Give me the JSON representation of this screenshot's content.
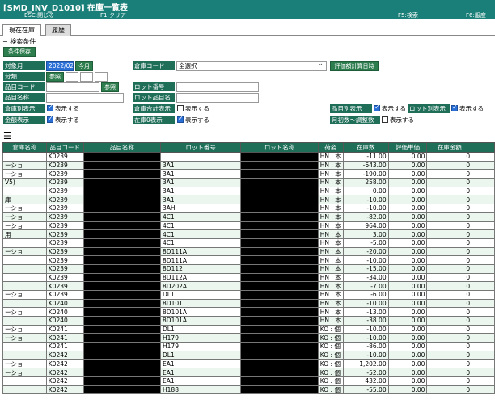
{
  "window": {
    "title": "[SMD_INV_D1010] 在庫一覧表",
    "fkeys": [
      {
        "key": "esc",
        "label": "ESC:閉じる"
      },
      {
        "key": "f1",
        "label": "F1:クリア"
      },
      {
        "key": "f5",
        "label": "F5:検索"
      },
      {
        "key": "f6",
        "label": "F6:服度"
      }
    ]
  },
  "tabs": [
    {
      "label": "現在在庫",
      "active": true
    },
    {
      "label": "履歴",
      "active": false
    }
  ],
  "search": {
    "section_label": "− 検索条件",
    "save_button": "条件保存",
    "target_month": {
      "label": "対象月",
      "value": "2022/02",
      "button": "今月"
    },
    "category": {
      "label": "分類",
      "button": "参照"
    },
    "item_code": {
      "label": "品目コード",
      "button": "参照"
    },
    "item_name": {
      "label": "品目名称"
    },
    "warehouse_code": {
      "label": "倉庫コード",
      "value": "全選択"
    },
    "eval_button": "評価額計算日時",
    "lot_number": {
      "label": "ロット番号"
    },
    "lot_item_name": {
      "label": "ロット品目名"
    },
    "warehouse_display": {
      "label": "倉庫別表示",
      "check": "表示する",
      "checked": true
    },
    "warehouse_total": {
      "label": "倉庫合計表示",
      "check": "表示する",
      "checked": false
    },
    "amount_display": {
      "label": "金額表示",
      "check": "表示する",
      "checked": true
    },
    "zero_display": {
      "label": "在庫0表示",
      "check": "表示する",
      "checked": true
    },
    "item_display": {
      "label": "品目別表示",
      "check": "表示する",
      "checked": true
    },
    "lot_display": {
      "label": "ロット別表示",
      "check": "表示する",
      "checked": true
    },
    "month_adjust": {
      "label": "月初数〜調整数",
      "check": "表示する",
      "checked": false
    }
  },
  "grid": {
    "columns": [
      "倉庫名称",
      "品目コード",
      "品目名称",
      "ロット番号",
      "ロット名称",
      "荷姿",
      "在庫数",
      "評価単価",
      "在庫金額"
    ],
    "rows": [
      [
        "",
        "K0239",
        "",
        "",
        "HN : 本",
        "-11.00",
        "0.00",
        "0"
      ],
      [
        "ーショ",
        "K0239",
        "",
        "3A1",
        "HN : 本",
        "-643.00",
        "0.00",
        "0"
      ],
      [
        "ーショ",
        "K0239",
        "",
        "3A1",
        "HN : 本",
        "-190.00",
        "0.00",
        "0"
      ],
      [
        "V5)",
        "K0239",
        "",
        "3A1",
        "HN : 本",
        "258.00",
        "0.00",
        "0"
      ],
      [
        "",
        "K0239",
        "",
        "3A1",
        "HN : 本",
        "0.00",
        "0.00",
        "0"
      ],
      [
        "庫",
        "K0239",
        "",
        "3A1",
        "HN : 本",
        "-10.00",
        "0.00",
        "0"
      ],
      [
        "ーショ",
        "K0239",
        "",
        "3AH",
        "HN : 本",
        "-10.00",
        "0.00",
        "0"
      ],
      [
        "ーショ",
        "K0239",
        "",
        "4C1",
        "HN : 本",
        "-82.00",
        "0.00",
        "0"
      ],
      [
        "ーショ",
        "K0239",
        "",
        "4C1",
        "HN : 本",
        "964.00",
        "0.00",
        "0"
      ],
      [
        "用",
        "K0239",
        "",
        "4C1",
        "HN : 本",
        "3.00",
        "0.00",
        "0"
      ],
      [
        "",
        "K0239",
        "",
        "4C1",
        "HN : 本",
        "-5.00",
        "0.00",
        "0"
      ],
      [
        "ーショ",
        "K0239",
        "",
        "8D111A",
        "HN : 本",
        "-20.00",
        "0.00",
        "0"
      ],
      [
        "",
        "K0239",
        "",
        "8D111A",
        "HN : 本",
        "-10.00",
        "0.00",
        "0"
      ],
      [
        "",
        "K0239",
        "",
        "8D112",
        "HN : 本",
        "-15.00",
        "0.00",
        "0"
      ],
      [
        "",
        "K0239",
        "",
        "8D112A",
        "HN : 本",
        "-34.00",
        "0.00",
        "0"
      ],
      [
        "",
        "K0239",
        "",
        "8D202A",
        "HN : 本",
        "-7.00",
        "0.00",
        "0"
      ],
      [
        "ーショ",
        "K0239",
        "",
        "DL1",
        "HN : 本",
        "-6.00",
        "0.00",
        "0"
      ],
      [
        "",
        "K0240",
        "",
        "8D101",
        "HN : 本",
        "-10.00",
        "0.00",
        "0"
      ],
      [
        "ーショ",
        "K0240",
        "",
        "8D101A",
        "HN : 本",
        "-13.00",
        "0.00",
        "0"
      ],
      [
        "",
        "K0240",
        "",
        "8D101A",
        "HN : 本",
        "-38.00",
        "0.00",
        "0"
      ],
      [
        "ーショ",
        "K0241",
        "",
        "DL1",
        "KO : 個",
        "-10.00",
        "0.00",
        "0"
      ],
      [
        "ーショ",
        "K0241",
        "",
        "H179",
        "KO : 個",
        "-10.00",
        "0.00",
        "0"
      ],
      [
        "",
        "K0241",
        "",
        "H179",
        "KO : 個",
        "-86.00",
        "0.00",
        "0"
      ],
      [
        "",
        "K0242",
        "",
        "DL1",
        "KO : 個",
        "-10.00",
        "0.00",
        "0"
      ],
      [
        "ーショ",
        "K0242",
        "",
        "EA1",
        "KO : 個",
        "1,202.00",
        "0.00",
        "0"
      ],
      [
        "ーショ",
        "K0242",
        "",
        "EA1",
        "KO : 個",
        "-52.00",
        "0.00",
        "0"
      ],
      [
        "",
        "K0242",
        "",
        "EA1",
        "KO : 個",
        "432.00",
        "0.00",
        "0"
      ],
      [
        "",
        "K0242",
        "",
        "H188",
        "KO : 個",
        "-55.00",
        "0.00",
        "0"
      ]
    ]
  },
  "icons": {
    "menu": "hamburger-menu-icon"
  }
}
